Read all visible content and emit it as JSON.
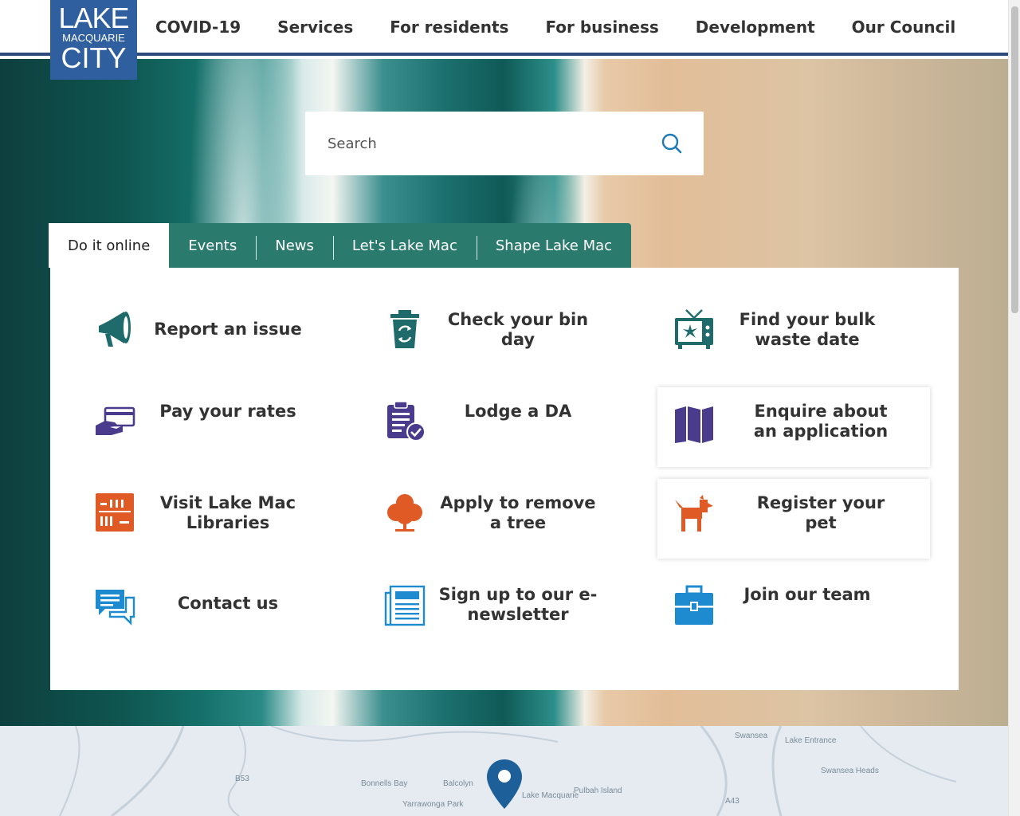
{
  "logo": {
    "line1": "LAKE",
    "line2": "MACQUARIE",
    "line3": "CITY"
  },
  "nav": {
    "items": [
      "COVID-19",
      "Services",
      "For residents",
      "For business",
      "Development",
      "Our Council"
    ]
  },
  "search": {
    "placeholder": "Search"
  },
  "tabs": [
    "Do it online",
    "Events",
    "News",
    "Let's Lake Mac",
    "Shape Lake Mac"
  ],
  "tiles": [
    {
      "label": "Report an issue",
      "icon": "megaphone-icon",
      "color": "#1f6b6b"
    },
    {
      "label": "Check your bin day",
      "icon": "recycle-bin-icon",
      "color": "#1f6b6b"
    },
    {
      "label": "Find your bulk waste date",
      "icon": "broken-tv-icon",
      "color": "#1f6b6b"
    },
    {
      "label": "Pay your rates",
      "icon": "credit-card-hand-icon",
      "color": "#4a3b8c"
    },
    {
      "label": "Lodge a DA",
      "icon": "clipboard-check-icon",
      "color": "#4a3b8c"
    },
    {
      "label": "Enquire about an application",
      "icon": "map-icon",
      "color": "#4a3b8c"
    },
    {
      "label": "Visit Lake Mac Libraries",
      "icon": "bookshelf-icon",
      "color": "#e05a26"
    },
    {
      "label": "Apply to remove a tree",
      "icon": "tree-icon",
      "color": "#e05a26"
    },
    {
      "label": "Register your pet",
      "icon": "dog-icon",
      "color": "#e05a26"
    },
    {
      "label": "Contact us",
      "icon": "chat-bubbles-icon",
      "color": "#1e8bd0"
    },
    {
      "label": "Sign up to our e-newsletter",
      "icon": "newspaper-icon",
      "color": "#1e8bd0"
    },
    {
      "label": "Join our team",
      "icon": "briefcase-icon",
      "color": "#1e8bd0"
    }
  ],
  "map": {
    "labels": [
      "Swansea",
      "Lake Entrance",
      "Swansea Heads",
      "Balcolyn",
      "Bonnells Bay",
      "Yarrawonga Park",
      "Pulbah Island",
      "Lake Macquarie",
      "B53",
      "A43"
    ]
  }
}
